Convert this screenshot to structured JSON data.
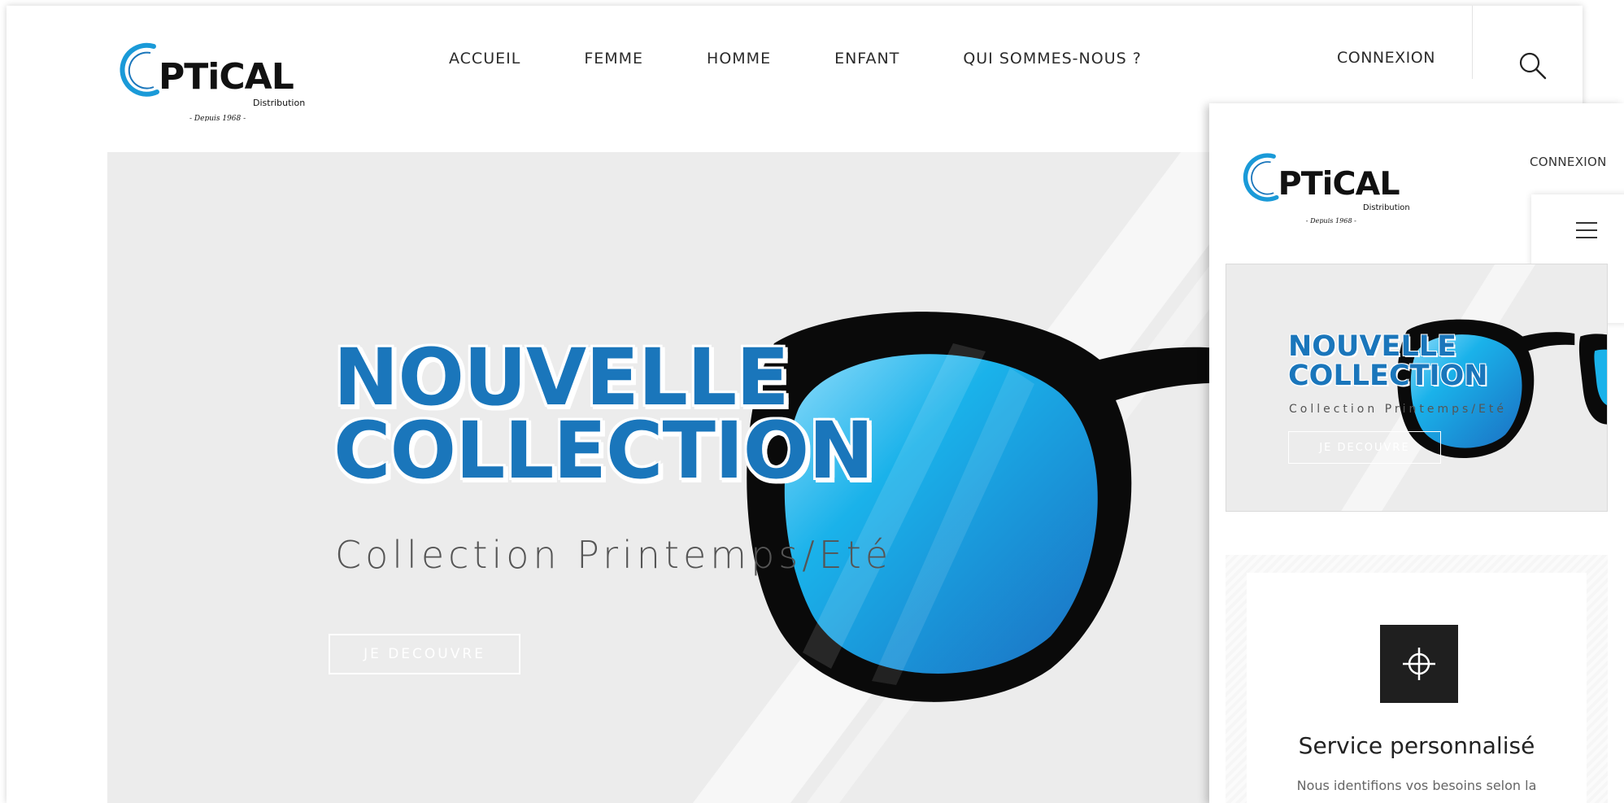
{
  "brand": {
    "logo_main": "PTiCAL",
    "logo_sub": "Distribution",
    "logo_tagline": "- Depuis 1968 -"
  },
  "desktop": {
    "nav": [
      {
        "label": "ACCUEIL"
      },
      {
        "label": "FEMME"
      },
      {
        "label": "HOMME"
      },
      {
        "label": "ENFANT"
      },
      {
        "label": "QUI SOMMES-NOUS ?"
      }
    ],
    "login_label": "CONNEXION",
    "hero": {
      "title_line1": "NOUVELLE",
      "title_line2": "COLLECTION",
      "subtitle": "Collection Printemps/Eté",
      "cta_label": "JE DECOUVRE"
    }
  },
  "mobile": {
    "login_label": "CONNEXION",
    "hero": {
      "title_line1": "NOUVELLE",
      "title_line2": "COLLECTION",
      "subtitle": "Collection Printemps/Eté",
      "cta_label": "JE DECOUVRE"
    },
    "service": {
      "title": "Service personnalisé",
      "text": "Nous identifions vos besoins selon la"
    }
  },
  "colors": {
    "brand_blue": "#1a76bb",
    "lens_blue": "#1ab2ea",
    "hero_bg": "#ececec",
    "icon_box": "#1f1f1f"
  }
}
